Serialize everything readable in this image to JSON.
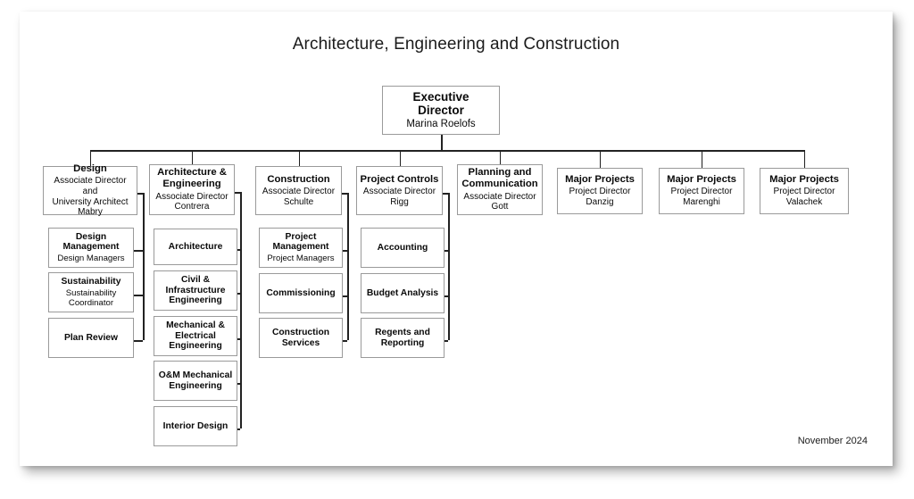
{
  "document": {
    "title": "Architecture, Engineering and Construction",
    "footer_date": "November 2024"
  },
  "chart_data": {
    "type": "diagram",
    "diagram_type": "organizational-chart",
    "title": "Architecture, Engineering and Construction",
    "date": "November 2024",
    "root": {
      "title": "Executive\nDirector",
      "title_line1": "Executive",
      "title_line2": "Director",
      "subtitle": "Marina Roelofs"
    },
    "divisions": [
      {
        "id": "design",
        "title": "Design",
        "title_lines": [
          "Design"
        ],
        "subtitle_lines": [
          "Associate Director and",
          "University Architect",
          "Mabry"
        ],
        "children": [
          {
            "title_lines": [
              "Design",
              "Management"
            ],
            "subtitle_lines": [
              "Design Managers"
            ]
          },
          {
            "title_lines": [
              "Sustainability"
            ],
            "subtitle_lines": [
              "Sustainability",
              "Coordinator"
            ]
          },
          {
            "title_lines": [
              "Plan Review"
            ],
            "subtitle_lines": []
          }
        ]
      },
      {
        "id": "architecture-engineering",
        "title": "Architecture & Engineering",
        "title_lines": [
          "Architecture &",
          "Engineering"
        ],
        "subtitle_lines": [
          "Associate Director",
          "Contrera"
        ],
        "children": [
          {
            "title_lines": [
              "Architecture"
            ],
            "subtitle_lines": []
          },
          {
            "title_lines": [
              "Civil &",
              "Infrastructure",
              "Engineering"
            ],
            "subtitle_lines": []
          },
          {
            "title_lines": [
              "Mechanical &",
              "Electrical",
              "Engineering"
            ],
            "subtitle_lines": []
          },
          {
            "title_lines": [
              "O&M Mechanical",
              "Engineering"
            ],
            "subtitle_lines": []
          },
          {
            "title_lines": [
              "Interior Design"
            ],
            "subtitle_lines": []
          }
        ]
      },
      {
        "id": "construction",
        "title": "Construction",
        "title_lines": [
          "Construction"
        ],
        "subtitle_lines": [
          "Associate Director",
          "Schulte"
        ],
        "children": [
          {
            "title_lines": [
              "Project",
              "Management"
            ],
            "subtitle_lines": [
              "Project Managers"
            ]
          },
          {
            "title_lines": [
              "Commissioning"
            ],
            "subtitle_lines": []
          },
          {
            "title_lines": [
              "Construction",
              "Services"
            ],
            "subtitle_lines": []
          }
        ]
      },
      {
        "id": "project-controls",
        "title": "Project Controls",
        "title_lines": [
          "Project Controls"
        ],
        "subtitle_lines": [
          "Associate Director",
          "Rigg"
        ],
        "children": [
          {
            "title_lines": [
              "Accounting"
            ],
            "subtitle_lines": []
          },
          {
            "title_lines": [
              "Budget Analysis"
            ],
            "subtitle_lines": []
          },
          {
            "title_lines": [
              "Regents and",
              "Reporting"
            ],
            "subtitle_lines": []
          }
        ]
      },
      {
        "id": "planning-communication",
        "title": "Planning and Communication",
        "title_lines": [
          "Planning and",
          "Communication"
        ],
        "subtitle_lines": [
          "Associate Director",
          "Gott"
        ],
        "children": []
      },
      {
        "id": "major-projects-danzig",
        "title": "Major Projects",
        "title_lines": [
          "Major Projects"
        ],
        "subtitle_lines": [
          "Project Director",
          "Danzig"
        ],
        "children": []
      },
      {
        "id": "major-projects-marenghi",
        "title": "Major Projects",
        "title_lines": [
          "Major Projects"
        ],
        "subtitle_lines": [
          "Project Director",
          "Marenghi"
        ],
        "children": []
      },
      {
        "id": "major-projects-valachek",
        "title": "Major Projects",
        "title_lines": [
          "Major Projects"
        ],
        "subtitle_lines": [
          "Project Director",
          "Valachek"
        ],
        "children": []
      }
    ]
  },
  "colors": {
    "page_background": "#ffffff",
    "box_border": "#9a9a9a",
    "connector": "#1f1f1f",
    "text": "#0a0a0a"
  }
}
